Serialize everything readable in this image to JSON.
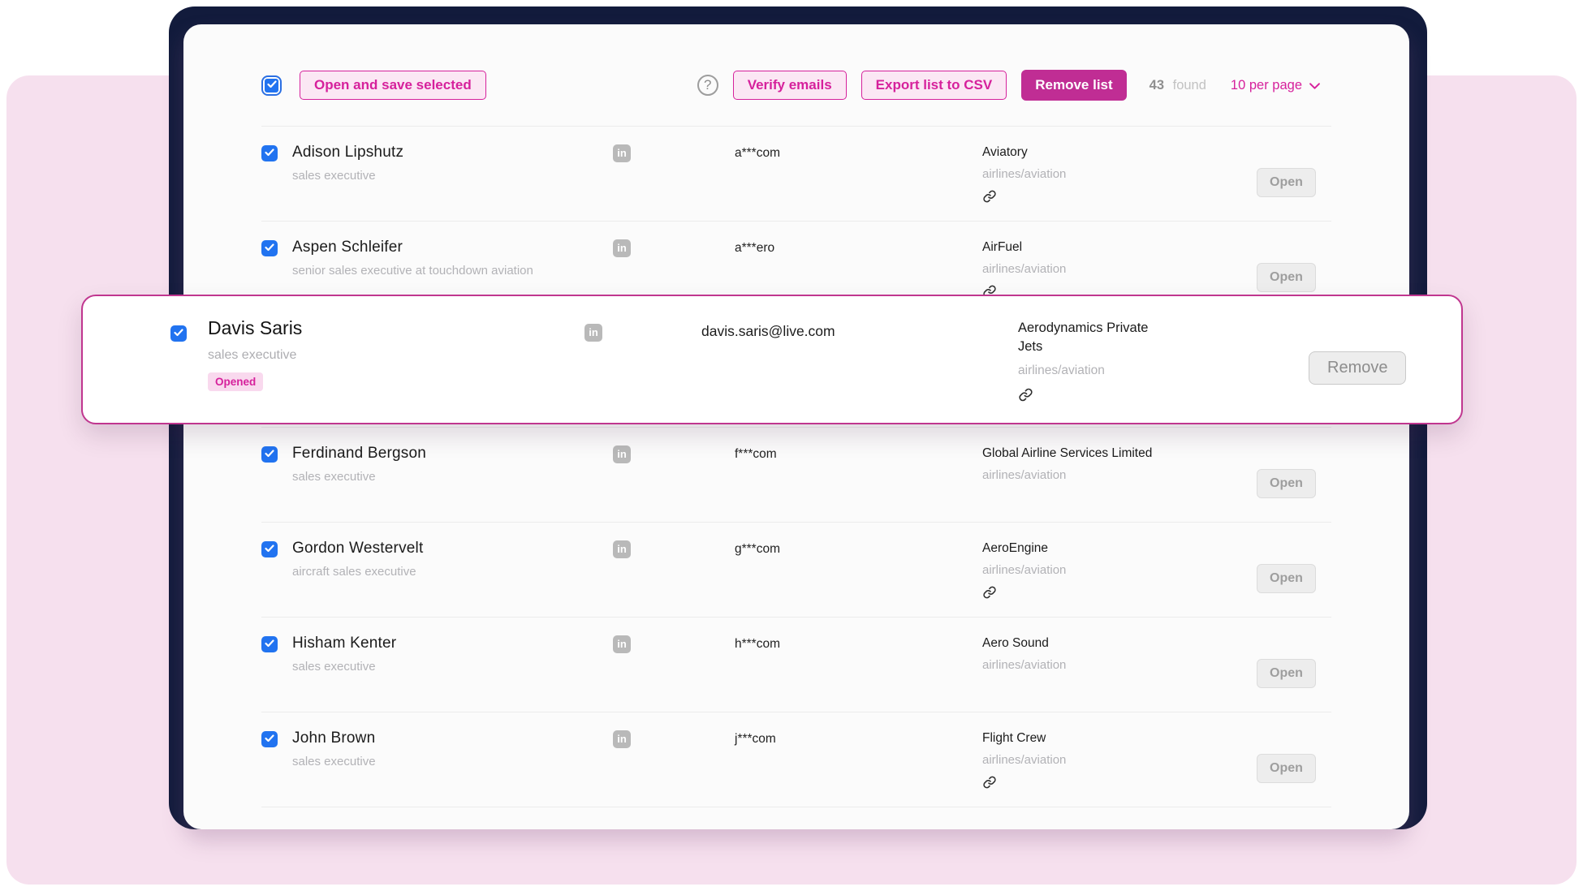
{
  "colors": {
    "accent": "#d6219c",
    "accent_fill": "#c02d94",
    "cb_blue": "#2173f0",
    "navy": "#121b3c",
    "pink_bg": "#f6e0ee"
  },
  "icons": {
    "linkedin": "in",
    "help": "?"
  },
  "toolbar": {
    "select_all_checked": true,
    "open_save_label": "Open and save selected",
    "verify_label": "Verify emails",
    "export_label": "Export list to CSV",
    "remove_list_label": "Remove list",
    "found_count": "43",
    "found_label": "found",
    "per_page_label": "10 per page"
  },
  "rows": [
    {
      "checked": true,
      "name": "Adison Lipshutz",
      "title": "sales executive",
      "email": "a***com",
      "company": "Aviatory",
      "industry": "airlines/aviation",
      "has_link": true,
      "action_label": "Open"
    },
    {
      "checked": true,
      "name": "Aspen Schleifer",
      "title": "senior sales executive at touchdown aviation",
      "email": "a***ero",
      "company": "AirFuel",
      "industry": "airlines/aviation",
      "has_link": true,
      "action_label": "Open"
    },
    {
      "checked": true,
      "name": "Ferdinand Bergson",
      "title": "sales executive",
      "email": "f***com",
      "company": "Global Airline Services Limited",
      "industry": "airlines/aviation",
      "has_link": false,
      "action_label": "Open"
    },
    {
      "checked": true,
      "name": "Gordon Westervelt",
      "title": "aircraft sales executive",
      "email": "g***com",
      "company": "AeroEngine",
      "industry": "airlines/aviation",
      "has_link": true,
      "action_label": "Open"
    },
    {
      "checked": true,
      "name": "Hisham Kenter",
      "title": "sales executive",
      "email": "h***com",
      "company": "Aero Sound",
      "industry": "airlines/aviation",
      "has_link": false,
      "action_label": "Open"
    },
    {
      "checked": true,
      "name": "John Brown",
      "title": "sales executive",
      "email": "j***com",
      "company": "Flight Crew",
      "industry": "airlines/aviation",
      "has_link": true,
      "action_label": "Open"
    }
  ],
  "popup": {
    "checked": true,
    "name": "Davis Saris",
    "title": "sales executive",
    "badge": "Opened",
    "email": "davis.saris@live.com",
    "company": "Aerodynamics Private Jets",
    "industry": "airlines/aviation",
    "has_link": true,
    "action_label": "Remove"
  }
}
